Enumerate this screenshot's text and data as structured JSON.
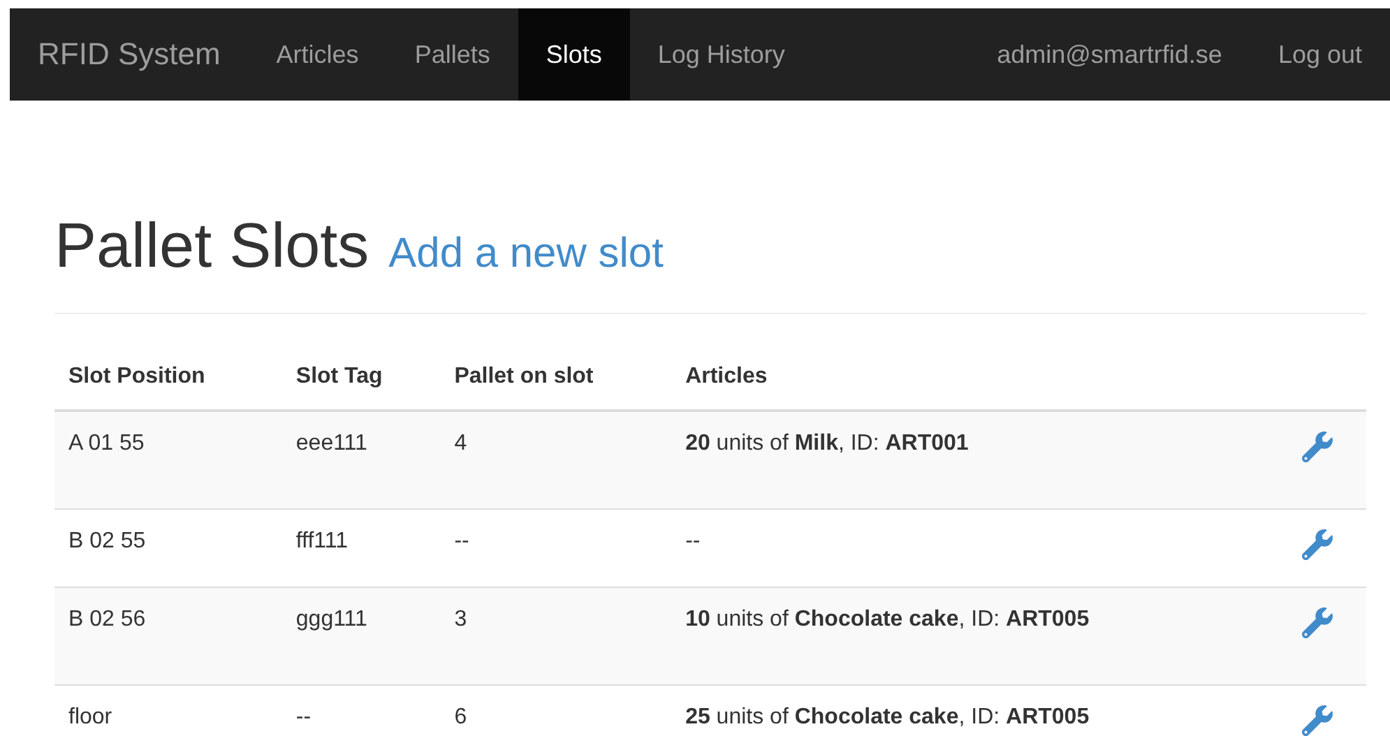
{
  "navbar": {
    "brand": "RFID System",
    "links": [
      {
        "label": "Articles",
        "selected": false
      },
      {
        "label": "Pallets",
        "selected": false
      },
      {
        "label": "Slots",
        "selected": true
      },
      {
        "label": "Log History",
        "selected": false
      }
    ],
    "user": "admin@smartrfid.se",
    "logout": "Log out"
  },
  "heading": {
    "title": "Pallet Slots",
    "link": "Add a new slot"
  },
  "table": {
    "columns": [
      "Slot Position",
      "Slot Tag",
      "Pallet on slot",
      "Articles"
    ],
    "rows": [
      {
        "position": "A 01 55",
        "tag": "eee111",
        "pallet": "4",
        "articles": "**20** units of **Milk**, ID: **ART001**"
      },
      {
        "position": "B 02 55",
        "tag": "fff111",
        "pallet": "--",
        "articles": "--"
      },
      {
        "position": "B 02 56",
        "tag": "ggg111",
        "pallet": "3",
        "articles": "**10** units of **Chocolate cake**, ID: **ART005**"
      },
      {
        "position": "floor",
        "tag": "--",
        "pallet": "6",
        "articles": "**25** units of **Chocolate cake**, ID: **ART005**"
      }
    ]
  }
}
